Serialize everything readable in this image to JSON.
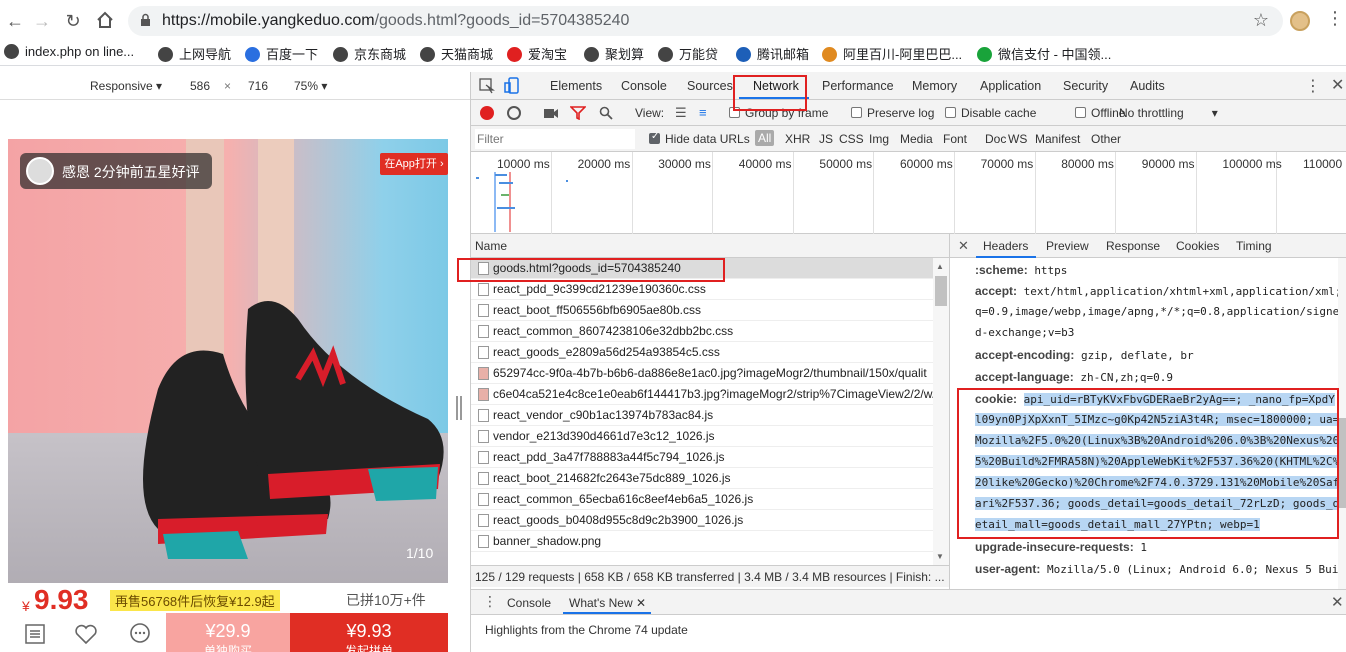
{
  "browser": {
    "url_host": "https://mobile.yangkeduo.com",
    "url_path": "/goods.html?goods_id=5704385240"
  },
  "bookmarks": [
    {
      "label": "index.php on line...",
      "color": "#444444"
    },
    {
      "label": "上网导航",
      "color": "#444444"
    },
    {
      "label": "百度一下",
      "color": "#2a6fe0"
    },
    {
      "label": "京东商城",
      "color": "#444444"
    },
    {
      "label": "天猫商城",
      "color": "#444444"
    },
    {
      "label": "爱淘宝",
      "color": "#e02020"
    },
    {
      "label": "聚划算",
      "color": "#444444"
    },
    {
      "label": "万能贷",
      "color": "#444444"
    },
    {
      "label": "腾讯邮箱",
      "color": "#1d5fb8"
    },
    {
      "label": "阿里百川-阿里巴巴...",
      "color": "#e08a20"
    },
    {
      "label": "微信支付 - 中国领...",
      "color": "#19a33a"
    }
  ],
  "device_toolbar": {
    "mode": "Responsive",
    "width": "586",
    "times": "×",
    "height": "716",
    "zoom": "75%"
  },
  "page": {
    "toast_text": "感恩 2分钟前五星好评",
    "open_app": "在App打开",
    "image_counter": "1/10",
    "price_symbol": "¥",
    "price": "9.93",
    "promo": "再售56768件后恢复¥12.9起",
    "sold": "已拼10万+件",
    "buy_alone_price": "¥29.9",
    "buy_alone_label": "单独购买",
    "buy_group_price": "¥9.93",
    "buy_group_label": "发起拼单"
  },
  "devtools": {
    "tabs": [
      "Elements",
      "Console",
      "Sources",
      "Network",
      "Performance",
      "Memory",
      "Application",
      "Security",
      "Audits"
    ],
    "network_toolbar": {
      "view": "View:",
      "group_by_frame": "Group by frame",
      "preserve_log": "Preserve log",
      "disable_cache": "Disable cache",
      "offline": "Offline",
      "throttling": "No throttling"
    },
    "filter": {
      "placeholder": "Filter",
      "hide_data_urls": "Hide data URLs",
      "types": [
        "All",
        "XHR",
        "JS",
        "CSS",
        "Img",
        "Media",
        "Font",
        "Doc",
        "WS",
        "Manifest",
        "Other"
      ]
    },
    "timeline_ticks": [
      "10000 ms",
      "20000 ms",
      "30000 ms",
      "40000 ms",
      "50000 ms",
      "60000 ms",
      "70000 ms",
      "80000 ms",
      "90000 ms",
      "100000 ms",
      "110000 ms"
    ],
    "name_header": "Name",
    "requests": [
      "goods.html?goods_id=5704385240",
      "react_pdd_9c399cd21239e190360c.css",
      "react_boot_ff506556bfb6905ae80b.css",
      "react_common_86074238106e32dbb2bc.css",
      "react_goods_e2809a56d254a93854c5.css",
      "652974cc-9f0a-4b7b-b6b6-da886e8e1ac0.jpg?imageMogr2/thumbnail/150x/qualit",
      "c6e04ca521e4c8ce1e0eab6f144417b3.jpg?imageMogr2/strip%7CimageView2/2/w/",
      "react_vendor_c90b1ac13974b783ac84.js",
      "vendor_e213d390d4661d7e3c12_1026.js",
      "react_pdd_3a47f788883a44f5c794_1026.js",
      "react_boot_214682fc2643e75dc889_1026.js",
      "react_common_65ecba616c8eef4eb6a5_1026.js",
      "react_goods_b0408d955c8d9c2b3900_1026.js",
      "banner_shadow.png"
    ],
    "summary": "125 / 129 requests  |  658 KB / 658 KB transferred  |  3.4 MB / 3.4 MB resources  |  Finish: ...",
    "detail_tabs": [
      "Headers",
      "Preview",
      "Response",
      "Cookies",
      "Timing"
    ],
    "headers": [
      {
        "name": ":scheme:",
        "value": "https"
      },
      {
        "name": "accept:",
        "value": "text/html,application/xhtml+xml,application/xml;"
      },
      {
        "name": "",
        "value": "q=0.9,image/webp,image/apng,*/*;q=0.8,application/signe"
      },
      {
        "name": "",
        "value": "d-exchange;v=b3"
      },
      {
        "name": "accept-encoding:",
        "value": "gzip, deflate, br"
      },
      {
        "name": "accept-language:",
        "value": "zh-CN,zh;q=0.9"
      }
    ],
    "cookie_name": "cookie:",
    "cookie_lines": [
      "api_uid=rBTyKVxFbvGDERaeBr2yAg==; _nano_fp=XpdY",
      "l09yn0PjXpXxnT_5IMzc~g0Kp42N5ziA3t4R; msec=1800000; ua=",
      "Mozilla%2F5.0%20(Linux%3B%20Android%206.0%3B%20Nexus%20",
      "5%20Build%2FMRA58N)%20AppleWebKit%2F537.36%20(KHTML%2C%",
      "20like%20Gecko)%20Chrome%2F74.0.3729.131%20Mobile%20Saf",
      "ari%2F537.36; goods_detail=goods_detail_72rLzD; goods_d",
      "etail_mall=goods_detail_mall_27YPtn; webp=1"
    ],
    "headers_after": [
      {
        "name": "upgrade-insecure-requests:",
        "value": "1"
      },
      {
        "name": "user-agent:",
        "value": "Mozilla/5.0 (Linux; Android 6.0; Nexus 5 Bui"
      }
    ],
    "drawer_tabs": [
      "Console",
      "What's New"
    ],
    "drawer_message": "Highlights from the Chrome 74 update"
  }
}
